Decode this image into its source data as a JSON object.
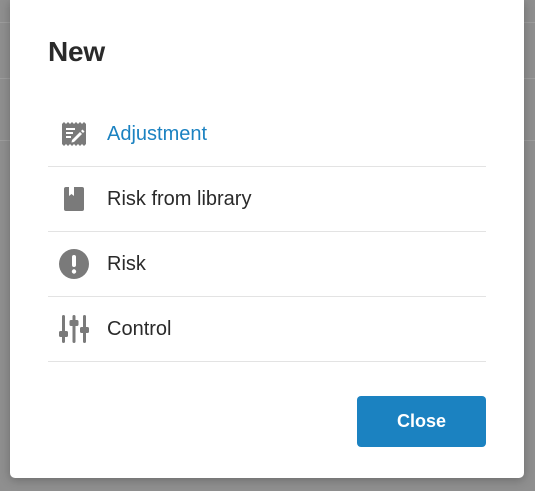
{
  "dialog": {
    "title": "New",
    "items": [
      {
        "label": "Adjustment",
        "icon": "adjustment-icon",
        "active": true
      },
      {
        "label": "Risk from library",
        "icon": "library-book-icon",
        "active": false
      },
      {
        "label": "Risk",
        "icon": "exclamation-circle-icon",
        "active": false
      },
      {
        "label": "Control",
        "icon": "sliders-icon",
        "active": false
      }
    ],
    "close_label": "Close"
  },
  "colors": {
    "accent": "#1b82c1",
    "icon": "#7a7a7a",
    "text": "#2a2a2a",
    "overlay": "#8f8f8f"
  }
}
